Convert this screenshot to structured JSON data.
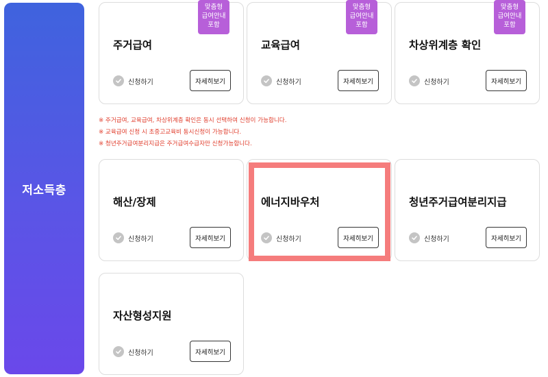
{
  "sidebar": {
    "title": "저소득층"
  },
  "cards": [
    {
      "title": "주거급여",
      "badge": [
        "맞춤형",
        "급여안내",
        "포함"
      ],
      "apply": "신청하기",
      "detail": "자세히보기"
    },
    {
      "title": "교육급여",
      "badge": [
        "맞춤형",
        "급여안내",
        "포함"
      ],
      "apply": "신청하기",
      "detail": "자세히보기"
    },
    {
      "title": "차상위계층 확인",
      "badge": [
        "맞춤형",
        "급여안내",
        "포함"
      ],
      "apply": "신청하기",
      "detail": "자세히보기"
    },
    {
      "title": "해산/장제",
      "apply": "신청하기",
      "detail": "자세히보기"
    },
    {
      "title": "에너지바우처",
      "apply": "신청하기",
      "detail": "자세히보기"
    },
    {
      "title": "청년주거급여분리지급",
      "apply": "신청하기",
      "detail": "자세히보기"
    },
    {
      "title": "자산형성지원",
      "apply": "신청하기",
      "detail": "자세히보기"
    }
  ],
  "notes": [
    "※ 주거급여, 교육급여, 차상위계층 확인은 동시 선택하여 신청이 가능합니다.",
    "※ 교육급여 신청 시 초중고교육비 동시신청이 가능합니다.",
    "※ 청년주거급여분리지급은 주거급여수급자만 신청가능합니다."
  ],
  "colors": {
    "sidebar_top": "#3f63de",
    "sidebar_bottom": "#6a48ea",
    "badge": "#b75fd9",
    "note": "#e03d2c",
    "highlight": "#f57c7c"
  },
  "icons": {
    "apply": "check-circle-icon"
  }
}
